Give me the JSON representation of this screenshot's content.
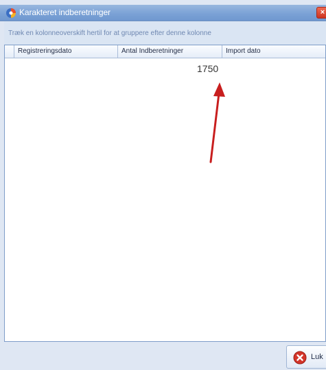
{
  "window": {
    "title": "Karakteret indberetninger",
    "close_glyph": "×"
  },
  "group_panel": {
    "hint": "Træk en kolonneoverskift hertil for at gruppere efter denne kolonne"
  },
  "grid": {
    "columns": [
      "Registreringsdato",
      "Antal Indberetninger",
      "Import dato"
    ],
    "rows": [
      {
        "antal": "1750"
      }
    ]
  },
  "footer": {
    "close_label": "Luk"
  },
  "colors": {
    "accent_red": "#c81e1e",
    "titlebar": "#7ba2d6"
  },
  "icons": {
    "app": "app-icon",
    "close": "close-icon",
    "luk": "close-x-circle-icon"
  }
}
